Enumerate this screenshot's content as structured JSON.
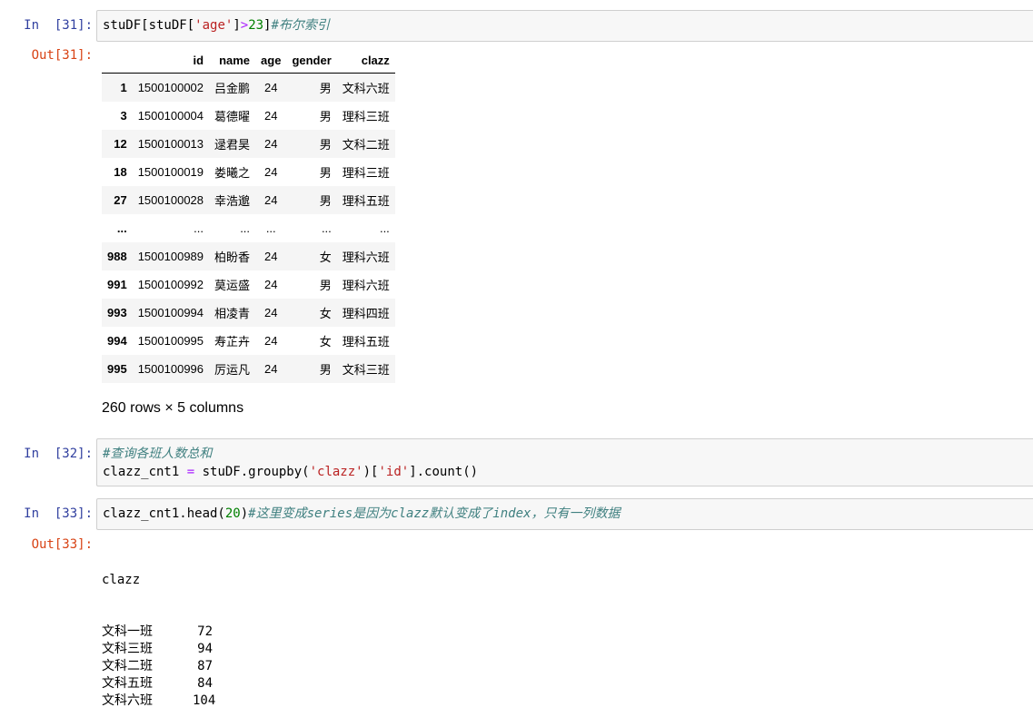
{
  "cells": [
    {
      "in_prompt": "In  [31]:",
      "code": {
        "a": "stuDF[stuDF[",
        "s1": "'age'",
        "b": "]",
        "op": ">",
        "num": "23",
        "c": "]",
        "comment": "#布尔索引"
      },
      "out_prompt": "Out[31]:",
      "table": {
        "columns": [
          "id",
          "name",
          "age",
          "gender",
          "clazz"
        ],
        "rows": [
          {
            "index": "1",
            "id": "1500100002",
            "name": "吕金鹏",
            "age": "24",
            "gender": "男",
            "clazz": "文科六班"
          },
          {
            "index": "3",
            "id": "1500100004",
            "name": "葛德曜",
            "age": "24",
            "gender": "男",
            "clazz": "理科三班"
          },
          {
            "index": "12",
            "id": "1500100013",
            "name": "逯君昊",
            "age": "24",
            "gender": "男",
            "clazz": "文科二班"
          },
          {
            "index": "18",
            "id": "1500100019",
            "name": "娄曦之",
            "age": "24",
            "gender": "男",
            "clazz": "理科三班"
          },
          {
            "index": "27",
            "id": "1500100028",
            "name": "幸浩邈",
            "age": "24",
            "gender": "男",
            "clazz": "理科五班"
          },
          {
            "index": "...",
            "id": "...",
            "name": "...",
            "age": "...",
            "gender": "...",
            "clazz": "..."
          },
          {
            "index": "988",
            "id": "1500100989",
            "name": "柏盼香",
            "age": "24",
            "gender": "女",
            "clazz": "理科六班"
          },
          {
            "index": "991",
            "id": "1500100992",
            "name": "莫运盛",
            "age": "24",
            "gender": "男",
            "clazz": "理科六班"
          },
          {
            "index": "993",
            "id": "1500100994",
            "name": "相凌青",
            "age": "24",
            "gender": "女",
            "clazz": "理科四班"
          },
          {
            "index": "994",
            "id": "1500100995",
            "name": "寿芷卉",
            "age": "24",
            "gender": "女",
            "clazz": "理科五班"
          },
          {
            "index": "995",
            "id": "1500100996",
            "name": "厉运凡",
            "age": "24",
            "gender": "男",
            "clazz": "文科三班"
          }
        ]
      },
      "rows_info": "260 rows × 5 columns"
    },
    {
      "in_prompt": "In  [32]:",
      "code": {
        "comment": "#查询各班人数总和",
        "a": "clazz_cnt1 ",
        "op": "=",
        "b": " stuDF.groupby(",
        "s1": "'clazz'",
        "c": ")[",
        "s2": "'id'",
        "d": "].count()"
      }
    },
    {
      "in_prompt": "In  [33]:",
      "code": {
        "a": "clazz_cnt1.head(",
        "num": "20",
        "b": ")",
        "comment": "#这里变成series是因为clazz默认变成了index，只有一列数据"
      },
      "out_prompt": "Out[33]:",
      "output": {
        "header": "clazz",
        "lines": [
          {
            "k": "文科一班",
            "v": "72"
          },
          {
            "k": "文科三班",
            "v": "94"
          },
          {
            "k": "文科二班",
            "v": "87"
          },
          {
            "k": "文科五班",
            "v": "84"
          },
          {
            "k": "文科六班",
            "v": "104"
          }
        ]
      }
    }
  ]
}
